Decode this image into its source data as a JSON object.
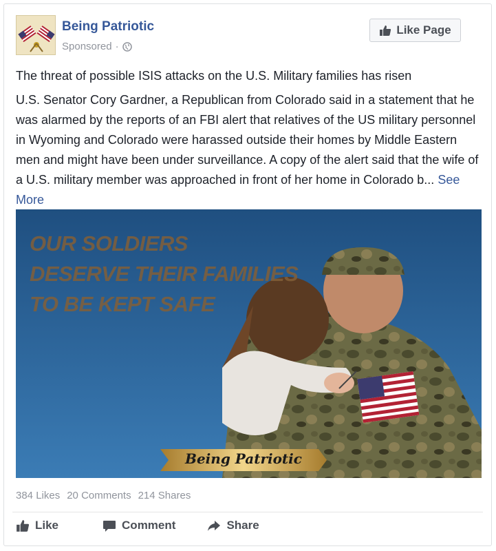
{
  "post": {
    "page_name": "Being Patriotic",
    "sponsored_label": "Sponsored",
    "separator": "·",
    "like_page_label": "Like Page",
    "headline": "The threat of possible ISIS attacks on the U.S. Military families has risen",
    "body": "U.S. Senator Cory Gardner, a Republican from Colorado said in a statement that he was alarmed by the reports of an FBI alert that relatives of the US military personnel in Wyoming and Colorado were harassed outside their homes by Middle Eastern men and might have been under surveillance. A copy of the alert said that the wife of a U.S. military member was approached in front of her home in Colorado b...",
    "see_more_label": "See More"
  },
  "image": {
    "overlay_lines": [
      "OUR SOLDIERS",
      "DESERVE THEIR FAMILIES",
      "TO BE KEPT SAFE"
    ],
    "watermark": "Being Patriotic"
  },
  "stats": {
    "likes": "384 Likes",
    "comments": "20 Comments",
    "shares": "214 Shares"
  },
  "actions": {
    "like": "Like",
    "comment": "Comment",
    "share": "Share"
  },
  "colors": {
    "link": "#365899",
    "muted": "#90949c",
    "button_text": "#4b4f56"
  },
  "icons": [
    "flag-icon",
    "globe-icon",
    "thumbs-up-icon",
    "comment-icon",
    "share-icon"
  ]
}
